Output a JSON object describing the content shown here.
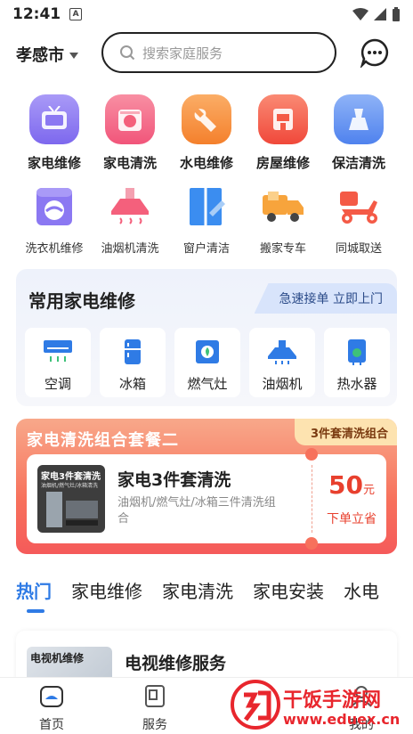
{
  "status_bar": {
    "time": "12:41",
    "notification_letter": "A"
  },
  "header": {
    "city": "孝感市",
    "search_placeholder": "搜索家庭服务"
  },
  "categories_primary": [
    {
      "label": "家电维修",
      "icon": "tv-icon",
      "color": "#8b78f2"
    },
    {
      "label": "家电清洗",
      "icon": "washer-clean-icon",
      "color": "#f4607c"
    },
    {
      "label": "水电维修",
      "icon": "wrench-icon",
      "color": "#f78a3c"
    },
    {
      "label": "房屋维修",
      "icon": "house-repair-icon",
      "color": "#f45a46"
    },
    {
      "label": "保洁清洗",
      "icon": "cleaning-icon",
      "color": "#5b8ef2"
    }
  ],
  "categories_secondary": [
    {
      "label": "洗衣机维修",
      "icon": "washing-machine-icon",
      "color": "#8b78f2"
    },
    {
      "label": "油烟机清洗",
      "icon": "range-hood-icon",
      "color": "#f4607c"
    },
    {
      "label": "窗户清洁",
      "icon": "window-icon",
      "color": "#3b8df0"
    },
    {
      "label": "搬家专车",
      "icon": "truck-icon",
      "color": "#f7a43c"
    },
    {
      "label": "同城取送",
      "icon": "scooter-icon",
      "color": "#f45a46"
    }
  ],
  "common_repair": {
    "title": "常用家电维修",
    "tag": "急速接单 立即上门",
    "items": [
      {
        "label": "空调",
        "icon": "air-conditioner-icon"
      },
      {
        "label": "冰箱",
        "icon": "fridge-icon"
      },
      {
        "label": "燃气灶",
        "icon": "gas-stove-icon"
      },
      {
        "label": "油烟机",
        "icon": "range-hood-icon"
      },
      {
        "label": "热水器",
        "icon": "water-heater-icon"
      }
    ]
  },
  "combo": {
    "title": "家电清洗组合套餐二",
    "badge": "3件套清洗组合",
    "thumb_title": "家电3件套清洗",
    "thumb_subtitle": "油烟机/燃气灶/冰箱清洗",
    "name": "家电3件套清洗",
    "desc": "油烟机/燃气灶/冰箱三件清洗组合",
    "price": "50",
    "price_unit": "元",
    "buy_label": "下单立省"
  },
  "tabs": [
    {
      "label": "热门",
      "active": true
    },
    {
      "label": "家电维修"
    },
    {
      "label": "家电清洗"
    },
    {
      "label": "家电安装"
    },
    {
      "label": "水电"
    }
  ],
  "service_item": {
    "image_text": "电视机维修",
    "name": "电视维修服务"
  },
  "bottom_nav": [
    {
      "label": "首页",
      "icon": "home-icon"
    },
    {
      "label": "服务",
      "icon": "service-icon"
    },
    {
      "label": "我的",
      "icon": "profile-icon"
    }
  ],
  "watermark": {
    "brand": "干饭手游网",
    "url": "www.eduex.cn"
  },
  "colors": {
    "accent": "#2f7be5",
    "price": "#e8402e"
  }
}
